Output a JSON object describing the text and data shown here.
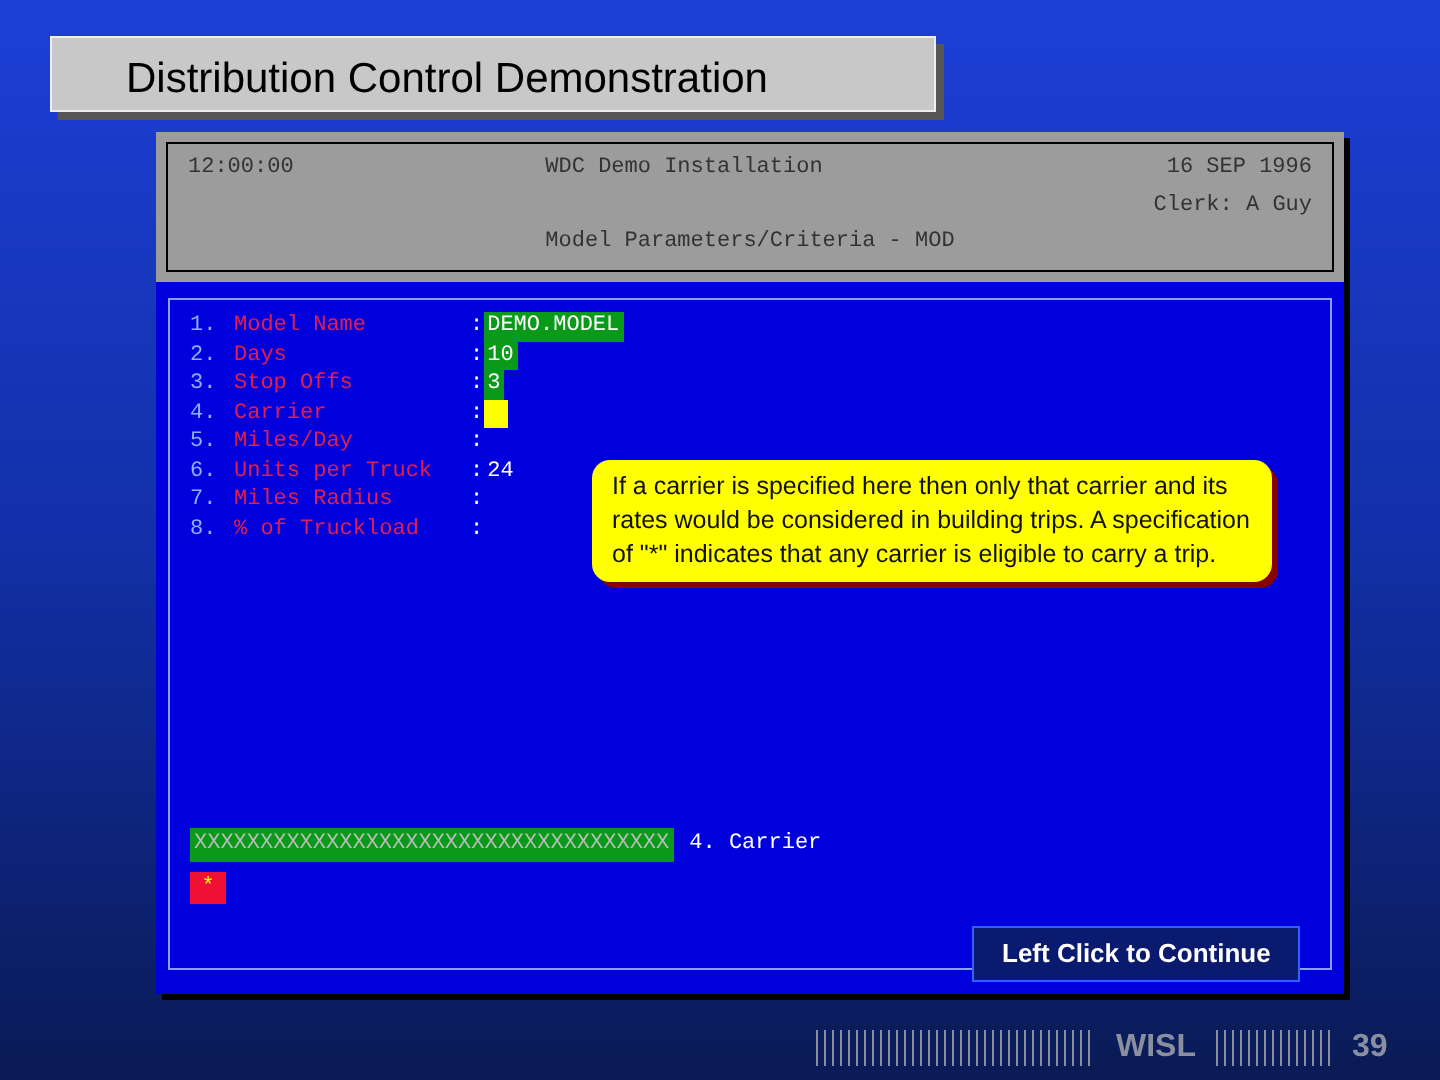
{
  "slide_title": "Distribution Control Demonstration",
  "terminal": {
    "header": {
      "time": "12:00:00",
      "installation": "WDC Demo Installation",
      "date": "16 SEP 1996",
      "clerk": "Clerk: A Guy",
      "screen_title": "Model Parameters/Criteria - MOD"
    },
    "fields": [
      {
        "number": "1.",
        "label": "Model Name",
        "separator": ":",
        "value": "DEMO.MODEL",
        "kind": "entered"
      },
      {
        "number": "2.",
        "label": "Days",
        "separator": ":",
        "value": "10",
        "kind": "entered"
      },
      {
        "number": "3.",
        "label": "Stop Offs",
        "separator": ":",
        "value": "3",
        "kind": "entered"
      },
      {
        "number": "4.",
        "label": "Carrier",
        "separator": ":",
        "kind": "cursor"
      },
      {
        "number": "5.",
        "label": "Miles/Day",
        "separator": ":",
        "kind": "plain"
      },
      {
        "number": "6.",
        "label": "Units per Truck",
        "separator": ":",
        "value": "24",
        "kind": "plain"
      },
      {
        "number": "7.",
        "label": "Miles Radius",
        "separator": ":",
        "kind": "plain"
      },
      {
        "number": "8.",
        "label": "% of Truckload",
        "separator": ":",
        "kind": "plain"
      }
    ],
    "help_note": "If a carrier is specified here then only that carrier and its rates would be considered in building trips. A specification of  \"*\" indicates that any carrier is eligible to carry a trip.",
    "prompt_bar": "XXXXXXXXXXXXXXXXXXXXXXXXXXXXXXXXXXXX",
    "prompt_label": "4. Carrier",
    "input_value": "*"
  },
  "continue_button": "Left Click to Continue",
  "footer": {
    "brand": "WISL",
    "page_number": "39"
  }
}
